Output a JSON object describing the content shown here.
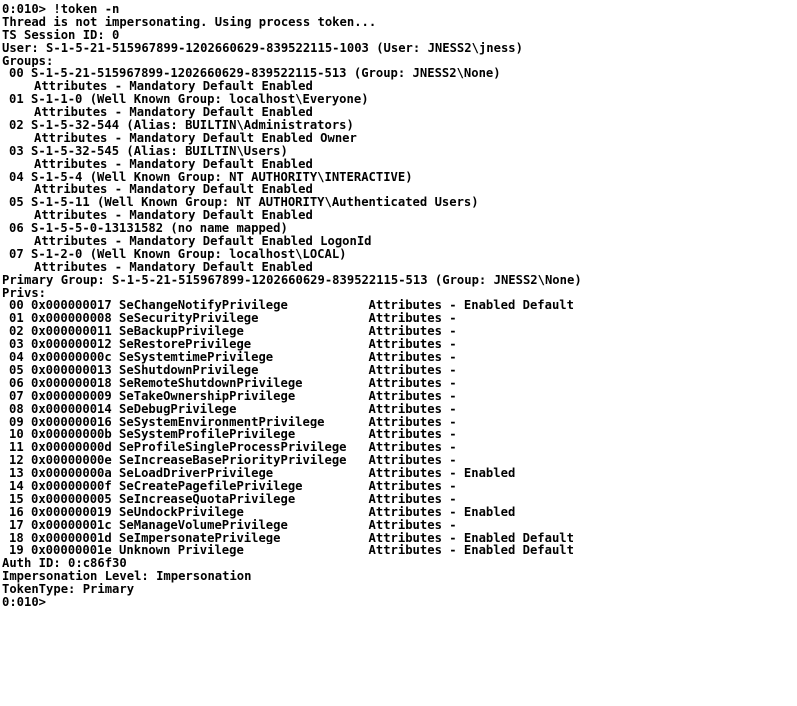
{
  "session": {
    "command_line": "0:010> !token -n",
    "thread_status": "Thread is not impersonating. Using process token...",
    "ts_session": "TS Session ID: 0",
    "user": "User: S-1-5-21-515967899-1202660629-839522115-1003 (User: JNESS2\\jness)",
    "groups_header": "Groups:",
    "groups": [
      {
        "entry": "00 S-1-5-21-515967899-1202660629-839522115-513 (Group: JNESS2\\None)",
        "attributes": "Attributes - Mandatory Default Enabled"
      },
      {
        "entry": "01 S-1-1-0 (Well Known Group: localhost\\Everyone)",
        "attributes": "Attributes - Mandatory Default Enabled"
      },
      {
        "entry": "02 S-1-5-32-544 (Alias: BUILTIN\\Administrators)",
        "attributes": "Attributes - Mandatory Default Enabled Owner"
      },
      {
        "entry": "03 S-1-5-32-545 (Alias: BUILTIN\\Users)",
        "attributes": "Attributes - Mandatory Default Enabled"
      },
      {
        "entry": "04 S-1-5-4 (Well Known Group: NT AUTHORITY\\INTERACTIVE)",
        "attributes": "Attributes - Mandatory Default Enabled"
      },
      {
        "entry": "05 S-1-5-11 (Well Known Group: NT AUTHORITY\\Authenticated Users)",
        "attributes": "Attributes - Mandatory Default Enabled"
      },
      {
        "entry": "06 S-1-5-5-0-13131582 (no name mapped)",
        "attributes": "Attributes - Mandatory Default Enabled LogonId"
      },
      {
        "entry": "07 S-1-2-0 (Well Known Group: localhost\\LOCAL)",
        "attributes": "Attributes - Mandatory Default Enabled"
      }
    ],
    "primary_group": "Primary Group: S-1-5-21-515967899-1202660629-839522115-513 (Group: JNESS2\\None)",
    "privs_header": "Privs:",
    "privs": [
      "00 0x000000017 SeChangeNotifyPrivilege           Attributes - Enabled Default",
      "01 0x000000008 SeSecurityPrivilege               Attributes -",
      "02 0x000000011 SeBackupPrivilege                 Attributes -",
      "03 0x000000012 SeRestorePrivilege                Attributes -",
      "04 0x00000000c SeSystemtimePrivilege             Attributes -",
      "05 0x000000013 SeShutdownPrivilege               Attributes -",
      "06 0x000000018 SeRemoteShutdownPrivilege         Attributes -",
      "07 0x000000009 SeTakeOwnershipPrivilege          Attributes -",
      "08 0x000000014 SeDebugPrivilege                  Attributes -",
      "09 0x000000016 SeSystemEnvironmentPrivilege      Attributes -",
      "10 0x00000000b SeSystemProfilePrivilege          Attributes -",
      "11 0x00000000d SeProfileSingleProcessPrivilege   Attributes -",
      "12 0x00000000e SeIncreaseBasePriorityPrivilege   Attributes -",
      "13 0x00000000a SeLoadDriverPrivilege             Attributes - Enabled",
      "14 0x00000000f SeCreatePagefilePrivilege         Attributes -",
      "15 0x000000005 SeIncreaseQuotaPrivilege          Attributes -",
      "16 0x000000019 SeUndockPrivilege                 Attributes - Enabled",
      "17 0x00000001c SeManageVolumePrivilege           Attributes -",
      "18 0x00000001d SeImpersonatePrivilege            Attributes - Enabled Default",
      "19 0x00000001e Unknown Privilege                 Attributes - Enabled Default"
    ],
    "auth_id": "Auth ID: 0:c86f30",
    "impersonation_level": "Impersonation Level: Impersonation",
    "token_type": "TokenType: Primary",
    "prompt": "0:010>"
  },
  "colors": {
    "background": "#ffffff",
    "text": "#000000"
  }
}
